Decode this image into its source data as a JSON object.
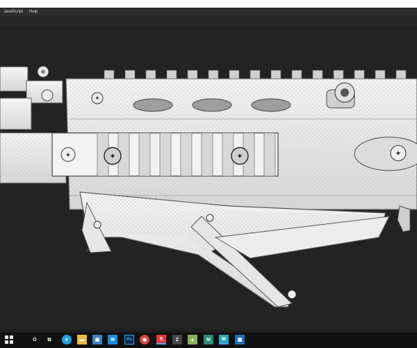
{
  "app": {
    "menu": [
      "JavaScript",
      "Help"
    ]
  },
  "taskbar": {
    "icons": [
      {
        "name": "search-circle-icon",
        "glyph": "O",
        "color": "#101010"
      },
      {
        "name": "task-view-icon",
        "glyph": "⧉",
        "color": "#101010"
      },
      {
        "name": "edge-browser-icon",
        "glyph": "e",
        "color": "#1fa0e0"
      },
      {
        "name": "file-explorer-icon",
        "glyph": "▬",
        "color": "#e8b84a"
      },
      {
        "name": "store-icon",
        "glyph": "▣",
        "color": "#3b82c4"
      },
      {
        "name": "mail-icon",
        "glyph": "✉",
        "color": "#1c8ad8"
      },
      {
        "name": "photoshop-icon",
        "glyph": "Ps",
        "color": "#0c2a4a"
      },
      {
        "name": "chrome-icon",
        "glyph": "◉",
        "color": "#d9463b"
      },
      {
        "name": "substance-icon",
        "glyph": "S",
        "color": "#e23b3b"
      },
      {
        "name": "zbrush-icon",
        "glyph": "Z",
        "color": "#444444"
      },
      {
        "name": "image-viewer-icon",
        "glyph": "▲",
        "color": "#8bb05a"
      },
      {
        "name": "marmoset-icon",
        "glyph": "M",
        "color": "#2a8a78"
      },
      {
        "name": "maya-icon",
        "glyph": "M",
        "color": "#2aa7b8"
      },
      {
        "name": "photo-gallery-icon",
        "glyph": "▦",
        "color": "#1d6fb8"
      }
    ]
  }
}
